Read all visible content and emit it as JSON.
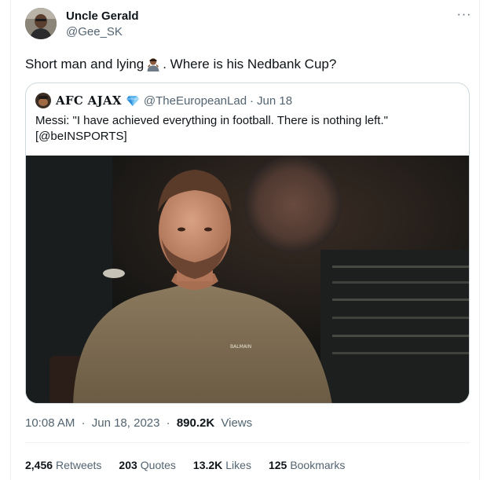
{
  "tweet": {
    "author": {
      "name": "Uncle Gerald",
      "handle": "@Gee_SK"
    },
    "more_icon": "ellipsis-icon",
    "text_before_emoji": "Short man and lying",
    "emoji": "person-shrugging-emoji",
    "text_after_emoji": ". Where is his Nedbank Cup?",
    "quoted": {
      "author_name": "AFC AJAX",
      "verified_icon": "diamond-badge-icon",
      "handle": "@TheEuropeanLad",
      "separator": "·",
      "date": "Jun 18",
      "text": "Messi: \"I have achieved everything in football. There is nothing left.\" [@beINSPORTS]",
      "media": "video-still-interview",
      "shirt_text": "BALMAIN"
    },
    "time": "10:08 AM",
    "date_sep": "·",
    "date": "Jun 18, 2023",
    "views_sep": "·",
    "views_count": "890.2K",
    "views_label": "Views",
    "stats": {
      "retweets": {
        "count": "2,456",
        "label": "Retweets"
      },
      "quotes": {
        "count": "203",
        "label": "Quotes"
      },
      "likes": {
        "count": "13.2K",
        "label": "Likes"
      },
      "bookmarks": {
        "count": "125",
        "label": "Bookmarks"
      }
    }
  },
  "colors": {
    "primary_text": "#0f1419",
    "secondary_text": "#536471",
    "border": "#cfd9de",
    "verified_blue": "#3aa0e8"
  }
}
